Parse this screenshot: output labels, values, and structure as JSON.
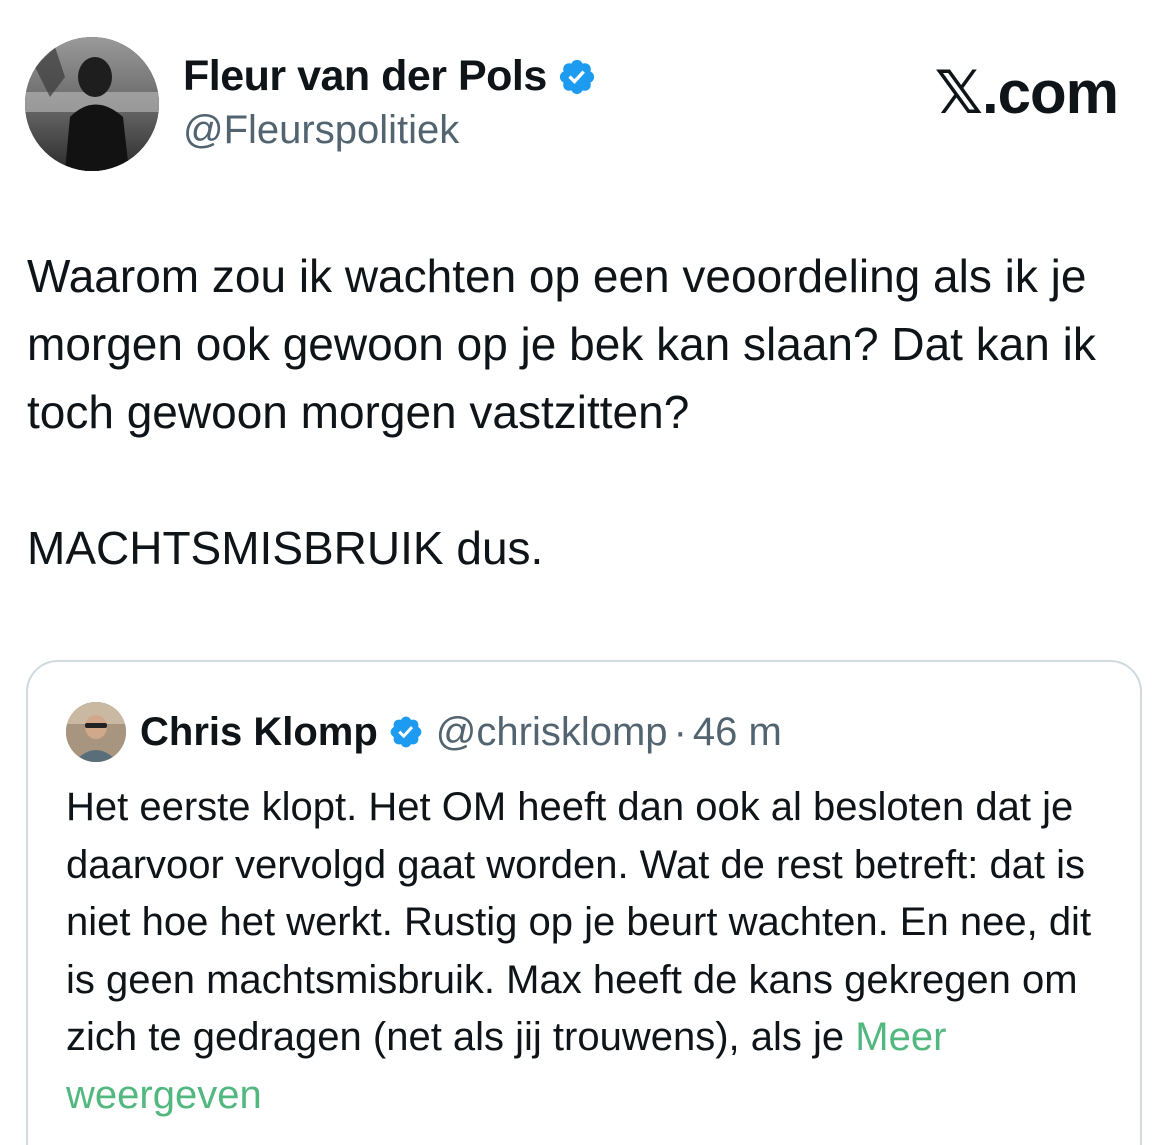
{
  "brand": {
    "logo_text": "𝕏.com"
  },
  "author": {
    "name": "Fleur van der Pols",
    "handle": "@Fleurspolitiek",
    "verified": true
  },
  "tweet": {
    "paragraphs": [
      "Waarom zou ik wachten op een veoordeling als ik je morgen ook gewoon op je bek kan slaan? Dat kan ik toch gewoon morgen vastzitten?",
      "MACHTSMISBRUIK dus."
    ]
  },
  "quote": {
    "name": "Chris Klomp",
    "handle": "@chrisklomp",
    "separator": "·",
    "time": "46 m",
    "verified": true,
    "text": "Het eerste klopt. Het OM heeft dan ook al besloten dat je daarvoor vervolgd gaat worden. Wat de rest betreft: dat is niet hoe het werkt. Rustig op je beurt wachten. En nee, dit is geen machtsmisbruik. Max heeft de kans gekregen om zich te gedragen (net als jij trouwens), als je ",
    "show_more": "Meer weergeven"
  },
  "colors": {
    "verified_blue": "#1d9bf0",
    "handle_gray": "#536471",
    "show_more_green": "#52b87f",
    "border": "#cfd9de"
  },
  "icons": {
    "verified": "verified-badge-icon",
    "brand": "x-logo-icon"
  }
}
